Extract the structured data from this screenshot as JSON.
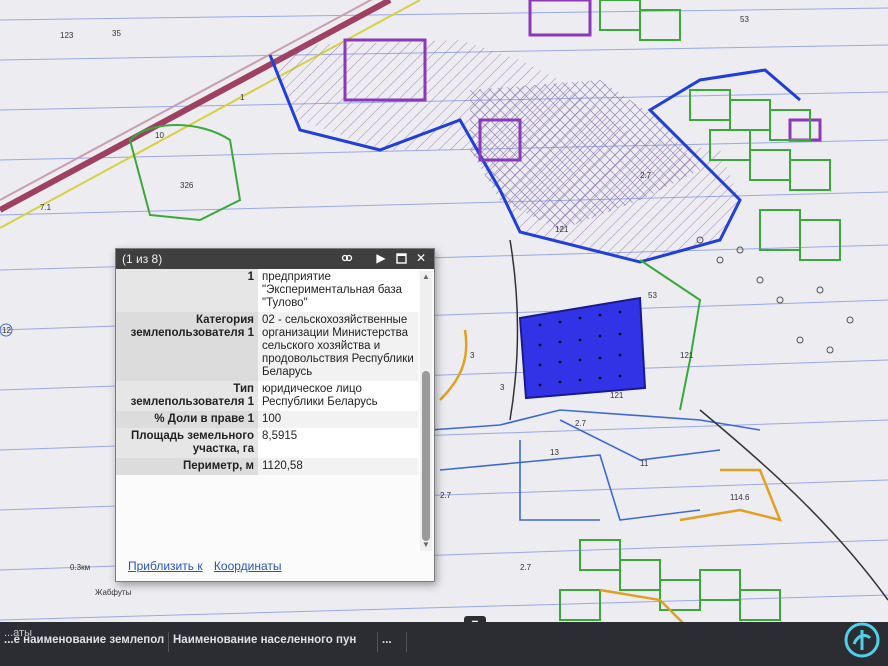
{
  "map": {
    "labels": [
      "123",
      "35",
      "1",
      "10",
      "326",
      "7.1",
      "12",
      "121",
      "53",
      "2.7",
      "3",
      "121",
      "121",
      "3",
      "2.7",
      "13",
      "11",
      "2.7",
      "2.7",
      "114.6",
      "0.3км",
      "Жабфуты",
      "53"
    ]
  },
  "popup": {
    "counter": "(1 из 8)",
    "rows": [
      {
        "key": "1",
        "value": "предприятие \"Экспериментальная база \"Тулово\""
      },
      {
        "key": "Категория землепользователя 1",
        "value": "02 - сельскохозяйственные организации Министерства сельского хозяйства и продовольствия Республики Беларусь"
      },
      {
        "key": "Тип землепользователя 1",
        "value": "юридическое лицо Республики Беларусь"
      },
      {
        "key": "% Доли в праве 1",
        "value": "100"
      },
      {
        "key": "Площадь земельного участка, га",
        "value": "8,5915"
      },
      {
        "key": "Периметр, м",
        "value": "1120,58"
      }
    ],
    "zoom_link": "Приблизить к",
    "coords_link": "Координаты"
  },
  "bottom_panel": {
    "title": "...аты",
    "columns": [
      "...е наименование землепол",
      "Наименование населенного пун",
      "..."
    ]
  },
  "colors": {
    "selected_parcel": "#3232e6",
    "boundary": "#1f3fd8",
    "parcel_green": "#3aa83a",
    "zone_purple": "#8a3ab8",
    "road_orange": "#e0a020"
  }
}
